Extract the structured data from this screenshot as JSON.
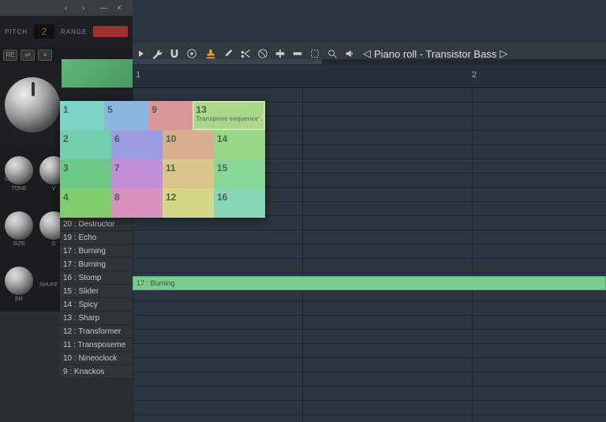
{
  "titlebar": {
    "prev": "‹",
    "next": "›",
    "min": "—",
    "close": "×"
  },
  "pitch": {
    "label": "PITCH",
    "value": "2",
    "range_label": "RANGE"
  },
  "strip": {
    "re": "RE",
    "share": "⇄",
    "menu": "≡"
  },
  "knobs": {
    "off": "OFF",
    "tone": "TONE",
    "v": "V",
    "size": "SIZE",
    "d": "D",
    "er": "ER",
    "shuff": "SHUFF"
  },
  "piano_roll": {
    "title": "Piano roll - Transistor Bass",
    "icons": [
      "wrench",
      "magnet",
      "target",
      "stamp",
      "brush",
      "cut",
      "mute",
      "slice",
      "select",
      "zoom",
      "speaker"
    ],
    "timeline": {
      "bar1": "1",
      "bar2": "2"
    }
  },
  "channels": [
    {
      "n": "20",
      "name": "Destructor"
    },
    {
      "n": "19",
      "name": "Echo"
    },
    {
      "n": "17",
      "name": "Burning"
    },
    {
      "n": "17",
      "name": "Burning"
    },
    {
      "n": "16",
      "name": "Stomp"
    },
    {
      "n": "15",
      "name": "Slider"
    },
    {
      "n": "14",
      "name": "Spicy"
    },
    {
      "n": "13",
      "name": "Sharp"
    },
    {
      "n": "12",
      "name": "Transformer"
    },
    {
      "n": "11",
      "name": "Transposeme"
    },
    {
      "n": "10",
      "name": "Nineoclock"
    },
    {
      "n": "9",
      "name": "Knackos"
    }
  ],
  "note": {
    "label": "17 : Burning"
  },
  "color_grid": {
    "transpose": "Transpose sequences",
    "cells": [
      [
        {
          "n": "1"
        },
        {
          "n": "5"
        },
        {
          "n": "9"
        },
        {
          "n": "13",
          "sub": "Transpose sequences",
          "sel": true
        }
      ],
      [
        {
          "n": "2"
        },
        {
          "n": "6"
        },
        {
          "n": "10"
        },
        {
          "n": "14"
        }
      ],
      [
        {
          "n": "3"
        },
        {
          "n": "7"
        },
        {
          "n": "11"
        },
        {
          "n": "15"
        }
      ],
      [
        {
          "n": "4"
        },
        {
          "n": "8"
        },
        {
          "n": "12"
        },
        {
          "n": "16"
        }
      ]
    ]
  }
}
